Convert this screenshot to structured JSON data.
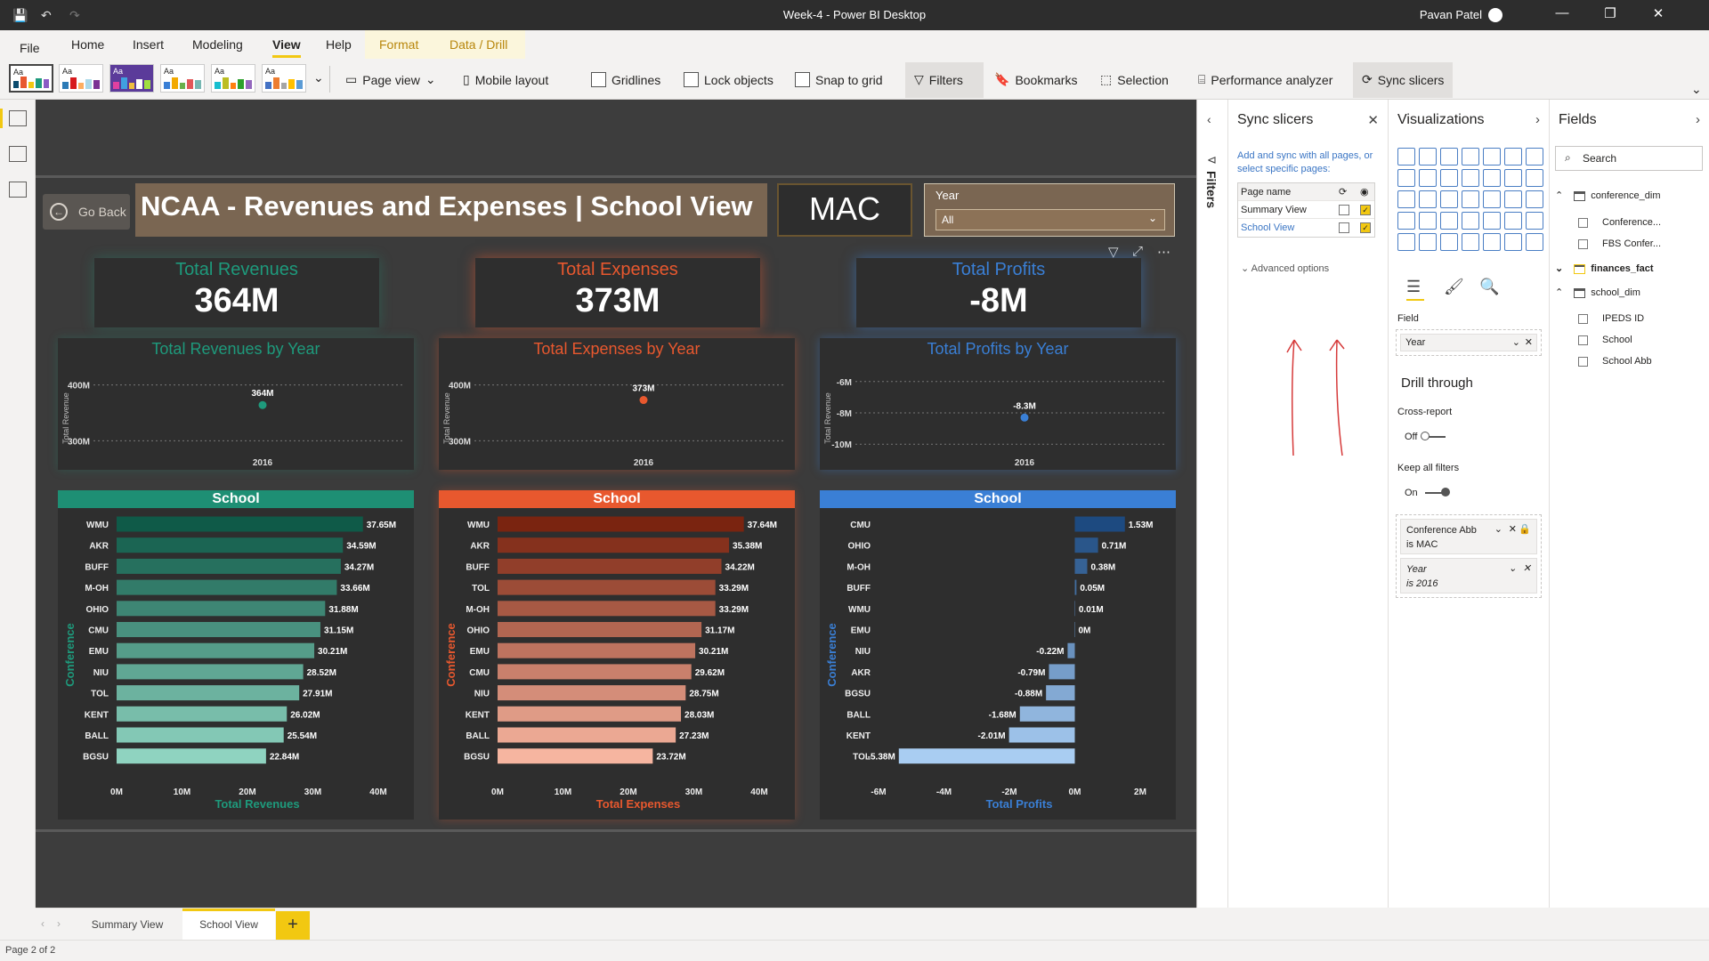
{
  "window": {
    "title": "Week-4 - Power BI Desktop",
    "user": "Pavan Patel"
  },
  "menu": {
    "tabs": [
      "File",
      "Home",
      "Insert",
      "Modeling",
      "View",
      "Help",
      "Format",
      "Data / Drill"
    ],
    "active": "View"
  },
  "ribbon": {
    "page_view": "Page view",
    "mobile_layout": "Mobile layout",
    "gridlines": "Gridlines",
    "lock_objects": "Lock objects",
    "snap_to_grid": "Snap to grid",
    "filters": "Filters",
    "bookmarks": "Bookmarks",
    "selection": "Selection",
    "performance_analyzer": "Performance analyzer",
    "sync_slicers": "Sync slicers",
    "theme_label": "Aa"
  },
  "report": {
    "go_back": "Go Back",
    "title": "NCAA - Revenues and Expenses | School View",
    "conference": "MAC",
    "slicer_label": "Year",
    "slicer_value": "All",
    "school_header": "School",
    "colors": {
      "revenue": "#1e9a7c",
      "expense": "#e8582e",
      "profit": "#3a7fd5"
    },
    "kpis": [
      {
        "title": "Total Revenues",
        "value": "364M"
      },
      {
        "title": "Total Expenses",
        "value": "373M"
      },
      {
        "title": "Total Profits",
        "value": "-8M"
      }
    ]
  },
  "chart_data": [
    {
      "type": "scatter",
      "title": "Total Revenues by Year",
      "ylabel": "Total Revenue",
      "x": [
        "2016"
      ],
      "y": [
        364
      ],
      "data_label": "364M",
      "yticks": [
        "400M",
        "300M"
      ]
    },
    {
      "type": "scatter",
      "title": "Total Expenses by Year",
      "ylabel": "Total Revenue",
      "x": [
        "2016"
      ],
      "y": [
        373
      ],
      "data_label": "373M",
      "yticks": [
        "400M",
        "300M"
      ]
    },
    {
      "type": "scatter",
      "title": "Total Profits by Year",
      "ylabel": "Total Revenue",
      "x": [
        "2016"
      ],
      "y": [
        -8.3
      ],
      "data_label": "-8.3M",
      "yticks": [
        "-6M",
        "-8M",
        "-10M"
      ]
    },
    {
      "type": "bar",
      "orientation": "horizontal",
      "title": "School",
      "ylabel": "Conference",
      "xlabel": "Total Revenues",
      "categories": [
        "WMU",
        "AKR",
        "BUFF",
        "M-OH",
        "OHIO",
        "CMU",
        "EMU",
        "NIU",
        "TOL",
        "KENT",
        "BALL",
        "BGSU"
      ],
      "values": [
        37.65,
        34.59,
        34.27,
        33.66,
        31.88,
        31.15,
        30.21,
        28.52,
        27.91,
        26.02,
        25.54,
        22.84
      ],
      "labels": [
        "37.65M",
        "34.59M",
        "34.27M",
        "33.66M",
        "31.88M",
        "31.15M",
        "30.21M",
        "28.52M",
        "27.91M",
        "26.02M",
        "25.54M",
        "22.84M"
      ],
      "xlim": [
        0,
        40
      ],
      "xticks": [
        "0M",
        "10M",
        "20M",
        "30M",
        "40M"
      ]
    },
    {
      "type": "bar",
      "orientation": "horizontal",
      "title": "School",
      "ylabel": "Conference",
      "xlabel": "Total Expenses",
      "categories": [
        "WMU",
        "AKR",
        "BUFF",
        "TOL",
        "M-OH",
        "OHIO",
        "EMU",
        "CMU",
        "NIU",
        "KENT",
        "BALL",
        "BGSU"
      ],
      "values": [
        37.64,
        35.38,
        34.22,
        33.29,
        33.29,
        31.17,
        30.21,
        29.62,
        28.75,
        28.03,
        27.23,
        23.72
      ],
      "labels": [
        "37.64M",
        "35.38M",
        "34.22M",
        "33.29M",
        "33.29M",
        "31.17M",
        "30.21M",
        "29.62M",
        "28.75M",
        "28.03M",
        "27.23M",
        "23.72M"
      ],
      "xlim": [
        0,
        40
      ],
      "xticks": [
        "0M",
        "10M",
        "20M",
        "30M",
        "40M"
      ]
    },
    {
      "type": "bar",
      "orientation": "horizontal",
      "title": "School",
      "ylabel": "Conference",
      "xlabel": "Total Profits",
      "categories": [
        "CMU",
        "OHIO",
        "M-OH",
        "BUFF",
        "WMU",
        "EMU",
        "NIU",
        "AKR",
        "BGSU",
        "BALL",
        "KENT",
        "TOL"
      ],
      "values": [
        1.53,
        0.71,
        0.38,
        0.05,
        0.01,
        0,
        -0.22,
        -0.79,
        -0.88,
        -1.68,
        -2.01,
        -5.38
      ],
      "labels": [
        "1.53M",
        "0.71M",
        "0.38M",
        "0.05M",
        "0.01M",
        "0M",
        "-0.22M",
        "-0.79M",
        "-0.88M",
        "-1.68M",
        "-2.01M",
        "-5.38M"
      ],
      "xlim": [
        -6,
        2
      ],
      "xticks": [
        "-6M",
        "-4M",
        "-2M",
        "0M",
        "2M"
      ]
    }
  ],
  "sync_pane": {
    "title": "Sync slicers",
    "description": "Add and sync with all pages, or select specific pages:",
    "column_header": "Page name",
    "pages": [
      {
        "name": "Summary View",
        "sync": false,
        "visible": true
      },
      {
        "name": "School View",
        "sync": false,
        "visible": true
      }
    ],
    "advanced": "Advanced options"
  },
  "viz_pane": {
    "title": "Visualizations",
    "field_label": "Field",
    "field_value": "Year",
    "drill_through": "Drill through",
    "cross_report": "Cross-report",
    "cross_report_state": "Off",
    "keep_filters": "Keep all filters",
    "keep_filters_state": "On",
    "filters": [
      {
        "name": "Conference Abb",
        "value": "is MAC"
      },
      {
        "name": "Year",
        "value": "is 2016"
      }
    ]
  },
  "fields_pane": {
    "title": "Fields",
    "search_placeholder": "Search",
    "tables": [
      {
        "name": "conference_dim",
        "fields": [
          "Conference...",
          "FBS Confer..."
        ]
      },
      {
        "name": "finances_fact",
        "fields": []
      },
      {
        "name": "school_dim",
        "fields": [
          "IPEDS ID",
          "School",
          "School Abb"
        ]
      }
    ]
  },
  "filters_strip_label": "Filters",
  "page_tabs": [
    "Summary View",
    "School View"
  ],
  "active_page": "School View",
  "status": "Page 2 of 2"
}
